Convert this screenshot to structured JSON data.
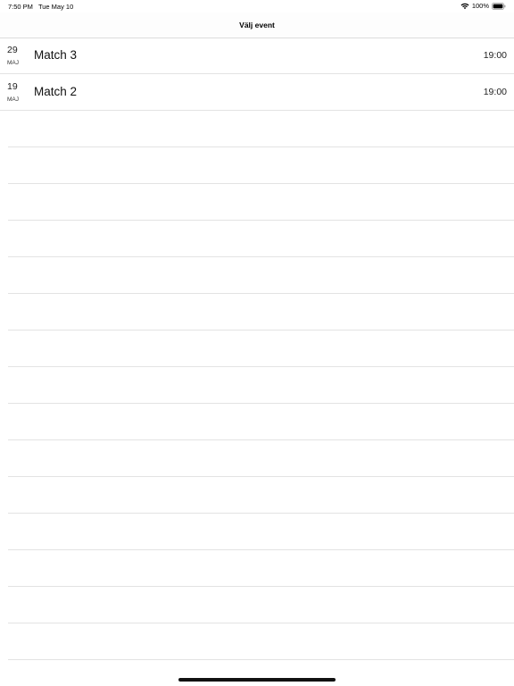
{
  "status_bar": {
    "time": "7:50 PM",
    "date": "Tue May 10",
    "battery": "100%"
  },
  "nav": {
    "title": "Välj event"
  },
  "events": [
    {
      "day": "29",
      "month": "MAJ",
      "title": "Match 3",
      "time": "19:00"
    },
    {
      "day": "19",
      "month": "MAJ",
      "title": "Match 2",
      "time": "19:00"
    }
  ],
  "colors": {
    "separator": "#e3e3e3",
    "text": "#111111",
    "background": "#ffffff"
  },
  "icons": {
    "wifi": "wifi-icon",
    "battery": "battery-icon"
  }
}
